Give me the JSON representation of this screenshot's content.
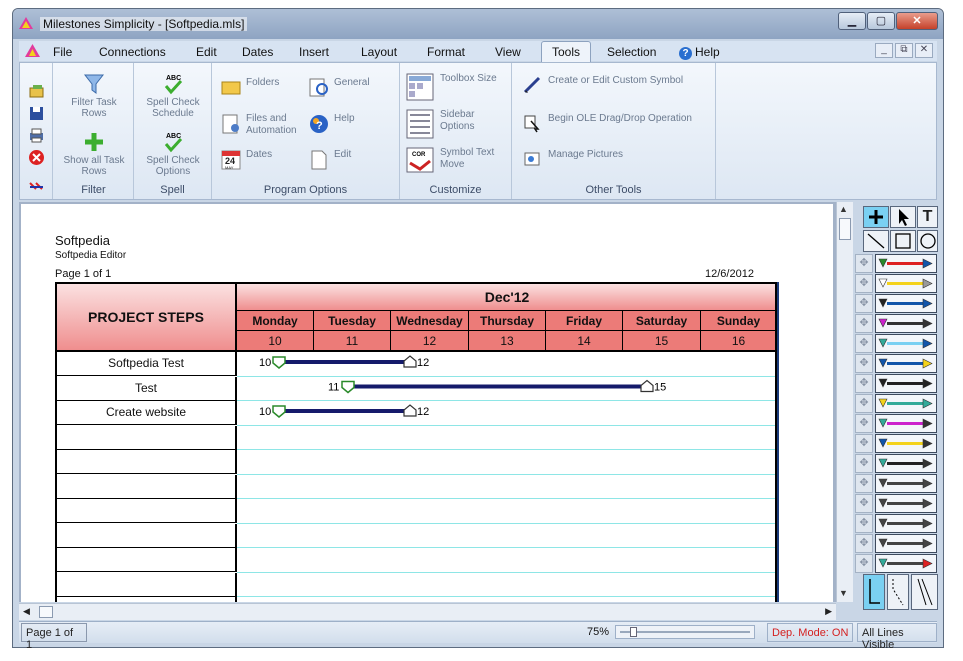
{
  "window": {
    "title": "Milestones Simplicity - [Softpedia.mls]",
    "min": "▁",
    "max": "▢",
    "close": "✕"
  },
  "menu": {
    "items": [
      "File",
      "Connections",
      "Edit",
      "Dates",
      "Insert",
      "Layout",
      "Format",
      "View",
      "Tools",
      "Selection",
      "Help"
    ],
    "active": "Tools",
    "mdi": [
      "_",
      "⧉",
      "✕"
    ]
  },
  "ribbon": {
    "filter": {
      "label": "Filter",
      "filter_task_rows": "Filter Task Rows",
      "show_all_task_rows": "Show all Task Rows"
    },
    "spell": {
      "label": "Spell",
      "check_schedule": "Spell Check Schedule",
      "check_options": "Spell Check Options"
    },
    "program_options": {
      "label": "Program Options",
      "folders": "Folders",
      "general": "General",
      "files_automation": "Files and Automation",
      "help": "Help",
      "dates": "Dates",
      "edit": "Edit",
      "cal_month": "MAY",
      "cal_day": "24"
    },
    "customize": {
      "label": "Customize",
      "toolbox_size": "Toolbox Size",
      "sidebar_options": "Sidebar Options",
      "symbol_text_move": "Symbol Text Move",
      "cor_badge": "COR"
    },
    "other_tools": {
      "label": "Other Tools",
      "custom_symbol": "Create or Edit Custom Symbol",
      "ole_drag": "Begin OLE Drag/Drop Operation",
      "manage_pictures": "Manage Pictures"
    }
  },
  "document": {
    "title": "Softpedia",
    "subtitle": "Softpedia Editor",
    "page_label": "Page 1 of 1",
    "date": "12/6/2012",
    "steps_header": "PROJECT STEPS",
    "month": "Dec'12",
    "days": [
      "Monday",
      "Tuesday",
      "Wednesday",
      "Thursday",
      "Friday",
      "Saturday",
      "Sunday"
    ],
    "dates": [
      "10",
      "11",
      "12",
      "13",
      "14",
      "15",
      "16"
    ],
    "tasks": [
      {
        "name": "Softpedia Test",
        "start": 10,
        "end": 12
      },
      {
        "name": "Test",
        "start": 11,
        "end": 15
      },
      {
        "name": "Create website",
        "start": 10,
        "end": 12
      }
    ],
    "empty_rows": 8
  },
  "toolbox": {
    "tools": [
      "plus-tool",
      "arrow-tool",
      "text-tool",
      "line-tool",
      "rect-tool",
      "ellipse-tool"
    ],
    "text_glyph": "T",
    "plus_glyph": "+"
  },
  "status": {
    "page": "Page 1 of 1",
    "zoom": "75%",
    "dep_mode": "Dep. Mode: ON",
    "lines": "All Lines Visible"
  },
  "colors": {
    "header_red": "#ec7b78",
    "grid_cyan": "#8ee6e6",
    "bar_navy": "#151a6b",
    "dep_mode": "#d42020"
  }
}
